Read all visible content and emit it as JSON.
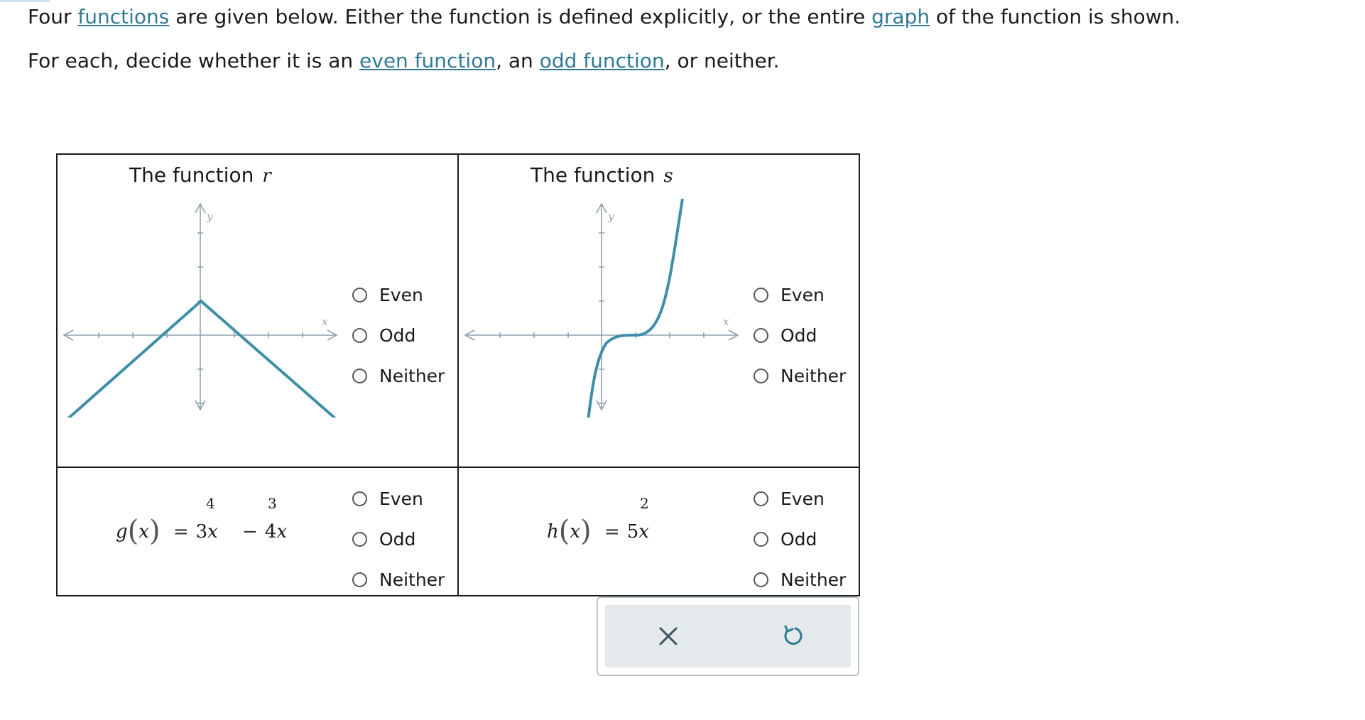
{
  "instructions": {
    "line1": {
      "t1": "Four ",
      "link_functions": "functions",
      "t2": " are given below. Either the function is defined explicitly, or the entire ",
      "link_graph": "graph",
      "t3": " of the function is shown."
    },
    "line2": {
      "t1": "For each, decide whether it is an ",
      "link_even": "even function",
      "t2": ", an ",
      "link_odd": "odd function",
      "t3": ", or neither."
    }
  },
  "cells": [
    {
      "title_prefix": "The function",
      "title_var": "r",
      "graph": {
        "x_axis_label": "x",
        "y_axis_label": "y",
        "curve": "inverted V with peak on the y-axis above the origin"
      },
      "options": [
        "Even",
        "Odd",
        "Neither"
      ]
    },
    {
      "title_prefix": "The function",
      "title_var": "s",
      "graph": {
        "x_axis_label": "x",
        "y_axis_label": "y",
        "curve": "cubic-shaped curve with flat section just right of the y-axis"
      },
      "options": [
        "Even",
        "Odd",
        "Neither"
      ]
    },
    {
      "formula": {
        "name": "g",
        "arg": "x",
        "eq": "=",
        "coef1": "3",
        "var1": "x",
        "exp1": "4",
        "minus": "−",
        "coef2": "4",
        "var2": "x",
        "exp2": "3"
      },
      "options": [
        "Even",
        "Odd",
        "Neither"
      ]
    },
    {
      "formula": {
        "name": "h",
        "arg": "x",
        "eq": "=",
        "coef1": "5",
        "var1": "x",
        "exp1": "2"
      },
      "options": [
        "Even",
        "Odd",
        "Neither"
      ]
    }
  ],
  "actions": {
    "clear_icon": "x-icon",
    "reset_icon": "undo-icon"
  },
  "colors": {
    "link": "#2f7a96",
    "curve": "#3f8ea8",
    "axis": "#8ea3ad",
    "action_bg": "#e4e9ec"
  }
}
